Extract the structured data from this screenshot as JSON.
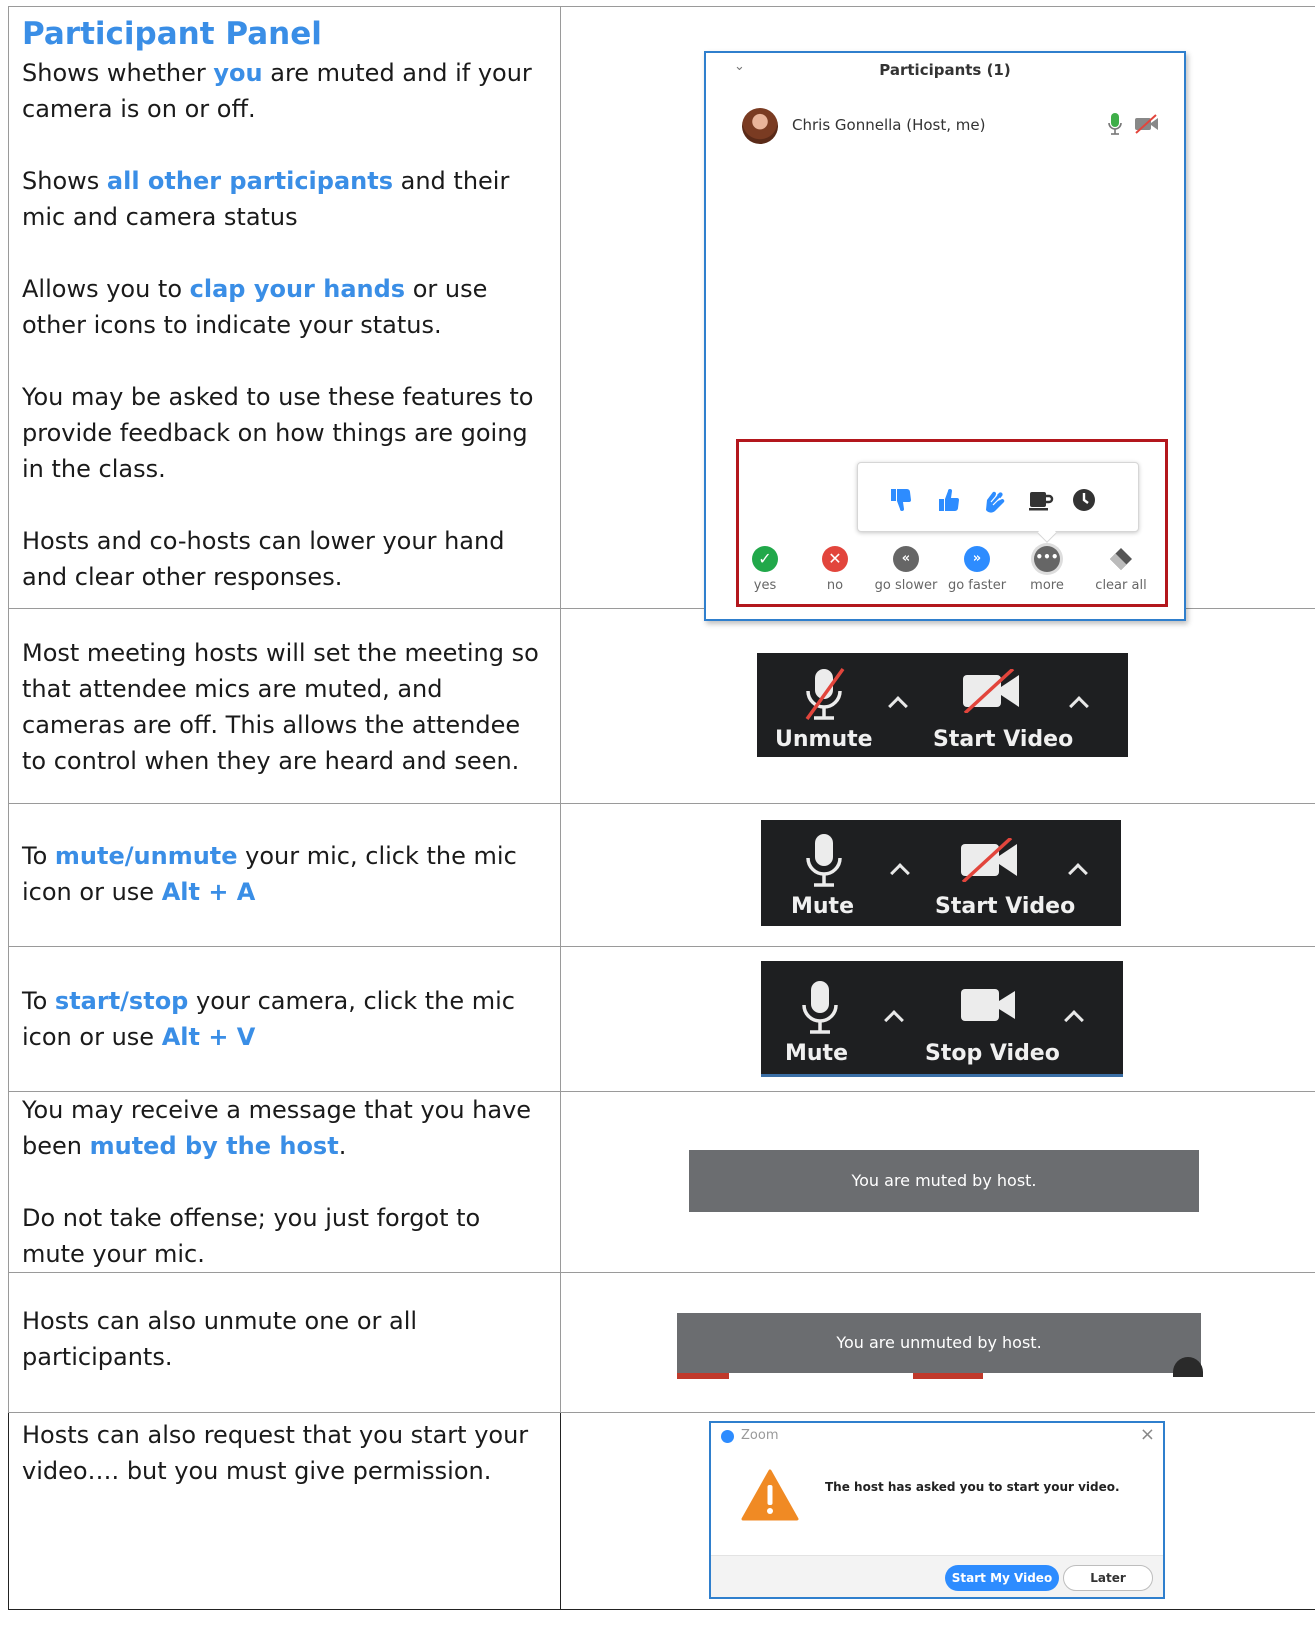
{
  "rows": [
    {
      "title": "Participant Panel",
      "paragraphs": [
        [
          "Shows whether ",
          "you",
          " are muted and if your camera is on or off."
        ],
        [
          "Shows ",
          "all other participants",
          " and their mic and camera status"
        ],
        [
          "Allows you to ",
          "clap your hands",
          " or use other icons to indicate your status."
        ],
        [
          "You may be asked to use these features to provide feedback on how things are going in the class."
        ],
        [
          "Hosts and co-hosts can lower your hand and clear other responses."
        ]
      ]
    },
    {
      "paragraphs": [
        [
          "Most meeting hosts will set the meeting so that attendee mics are muted, and cameras are off. This allows the attendee to control when they are heard and seen."
        ]
      ]
    },
    {
      "paragraphs": [
        [
          "To ",
          "mute/unmute",
          " your mic, click the mic icon or use ",
          "Alt + A"
        ]
      ]
    },
    {
      "paragraphs": [
        [
          "To ",
          "start/stop",
          " your camera, click the mic icon or use ",
          "Alt + V"
        ]
      ]
    },
    {
      "paragraphs": [
        [
          "You may receive a message that you have been ",
          "muted by the host",
          "."
        ],
        [
          "Do not take offense; you just forgot to mute your mic."
        ]
      ]
    },
    {
      "paragraphs": [
        [
          "Hosts can also unmute one or all participants."
        ]
      ]
    },
    {
      "paragraphs": [
        [
          "Hosts can also request that you start your video…. but you must give permission."
        ]
      ]
    }
  ],
  "participants_panel": {
    "title": "Participants (1)",
    "participant_name": "Chris Gonnella (Host, me)",
    "reactions": [
      {
        "label": "yes",
        "icon": "check-icon",
        "color": "#21a84a"
      },
      {
        "label": "no",
        "icon": "x-icon",
        "color": "#e2453c"
      },
      {
        "label": "go slower",
        "icon": "rewind-icon",
        "color": "#666666"
      },
      {
        "label": "go faster",
        "icon": "fast-forward-icon",
        "color": "#2d8cff"
      },
      {
        "label": "more",
        "icon": "more-icon",
        "color": "#666666"
      },
      {
        "label": "clear all",
        "icon": "eraser-icon",
        "color": "#555555"
      }
    ],
    "popup_icons": [
      "thumbs-down-icon",
      "thumbs-up-icon",
      "clap-icon",
      "coffee-icon",
      "clock-icon"
    ]
  },
  "toolbars": [
    {
      "left_label": "Unmute",
      "right_label": "Start Video"
    },
    {
      "left_label": "Mute",
      "right_label": "Start Video"
    },
    {
      "left_label": "Mute",
      "right_label": "Stop Video"
    }
  ],
  "toasts": {
    "muted": "You are muted by host.",
    "unmuted": "You are unmuted by host."
  },
  "dialog": {
    "app": "Zoom",
    "close": "×",
    "message": "The host has asked you to start your video.",
    "primary": "Start My Video",
    "secondary": "Later"
  }
}
